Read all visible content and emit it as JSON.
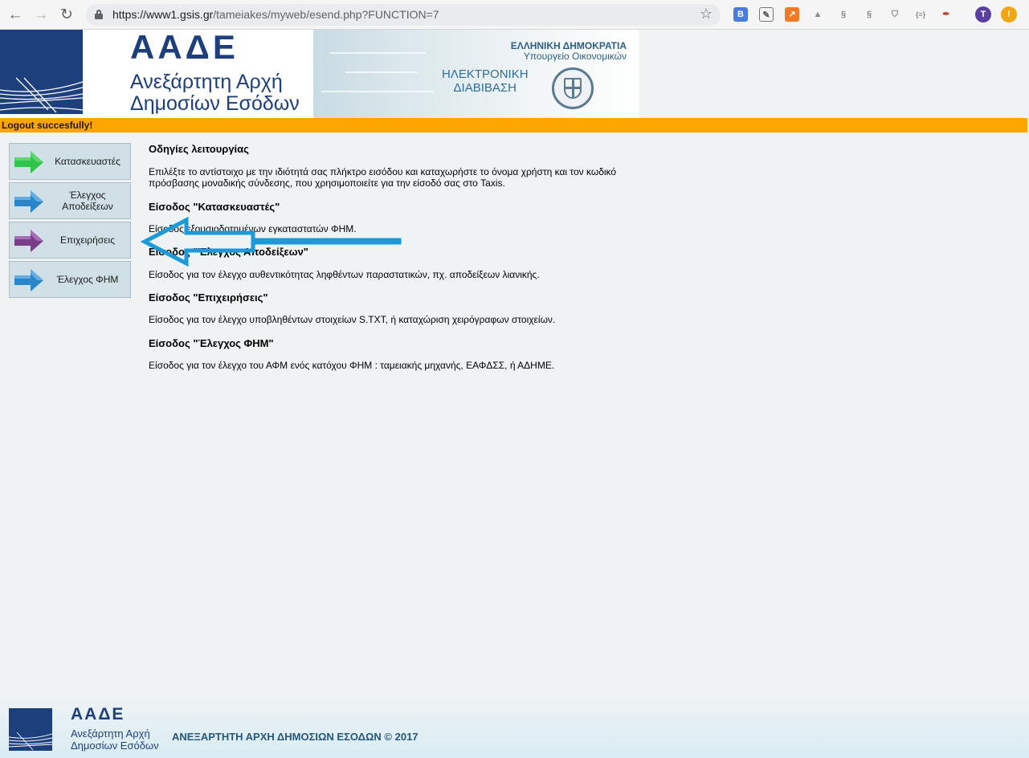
{
  "browser": {
    "url_host": "https://www1.gsis.gr",
    "url_path": "/tameiakes/myweb/esend.php?FUNCTION=7",
    "profile_initial": "T"
  },
  "header": {
    "brand_short": "ΑΑΔΕ",
    "brand_line1": "Ανεξάρτητη Αρχή",
    "brand_line2": "Δημοσίων Εσόδων",
    "gov_title": "ΕΛΛΗΝΙΚΗ ΔΗΜΟΚΡΑΤΙΑ",
    "gov_subtitle": "Υπουργείο Οικονομικών",
    "ereader_line1": "ΗΛΕΚΤΡΟΝΙΚΗ",
    "ereader_line2": "ΔΙΑΒΙΒΑΣΗ"
  },
  "status": {
    "message": "Logout succesfully!",
    "color": "#ffa500"
  },
  "menu": {
    "items": [
      {
        "label": "Κατασκευαστές",
        "arrow_color": "#2fc44a"
      },
      {
        "label": "Έλεγχος Αποδείξεων",
        "arrow_color": "#2a86c9"
      },
      {
        "label": "Επιχειρήσεις",
        "arrow_color": "#7b3f8a"
      },
      {
        "label": "Έλεγχος ΦΗΜ",
        "arrow_color": "#2a86c9"
      }
    ]
  },
  "instructions": {
    "title": "Οδηγίες λειτουργίας",
    "intro": "Επιλέξτε το αντίστοιχο με την ιδιότητά σας πλήκτρο εισόδου και καταχωρήστε το όνομα χρήστη και τον κωδικό πρόσβασης μοναδικής σύνδεσης, που χρησιμοποιείτε για την είσοδό σας στο Taxis.",
    "sections": [
      {
        "heading": "Είσοδος \"Κατασκευαστές\"",
        "text": "Είσοδος εξουσιοδοτημένων εγκαταστατών ΦΗΜ."
      },
      {
        "heading": "Είσοδος \"Έλεγχος Αποδείξεων\"",
        "text": "Είσοδος για τον έλεγχο αυθεντικότητας ληφθέντων παραστατικών, πχ. αποδείξεων λιανικής."
      },
      {
        "heading": "Είσοδος \"Επιχειρήσεις\"",
        "text": "Είσοδος για τον έλεγχο υποβληθέντων στοιχείων S.TXT, ή καταχώριση χειρόγραφων στοιχείων."
      },
      {
        "heading": "Είσοδος \"Έλεγχος ΦΗΜ\"",
        "text": "Είσοδος για τον έλεγχο του ΑΦΜ ενός κατόχου ΦΗΜ : ταμειακής μηχανής, ΕΑΦΔΣΣ, ή ΑΔΗΜΕ."
      }
    ]
  },
  "footer": {
    "brand_short": "ΑΑΔΕ",
    "brand_line1": "Ανεξάρτητη Αρχή",
    "brand_line2": "Δημοσίων Εσόδων",
    "copyright": "ΑΝΕΞΑΡΤΗΤΗ ΑΡΧΗ ΔΗΜΟΣΙΩΝ ΕΣΟΔΩΝ © 2017"
  },
  "annotation": {
    "arrow_color": "#1a9ad9"
  }
}
